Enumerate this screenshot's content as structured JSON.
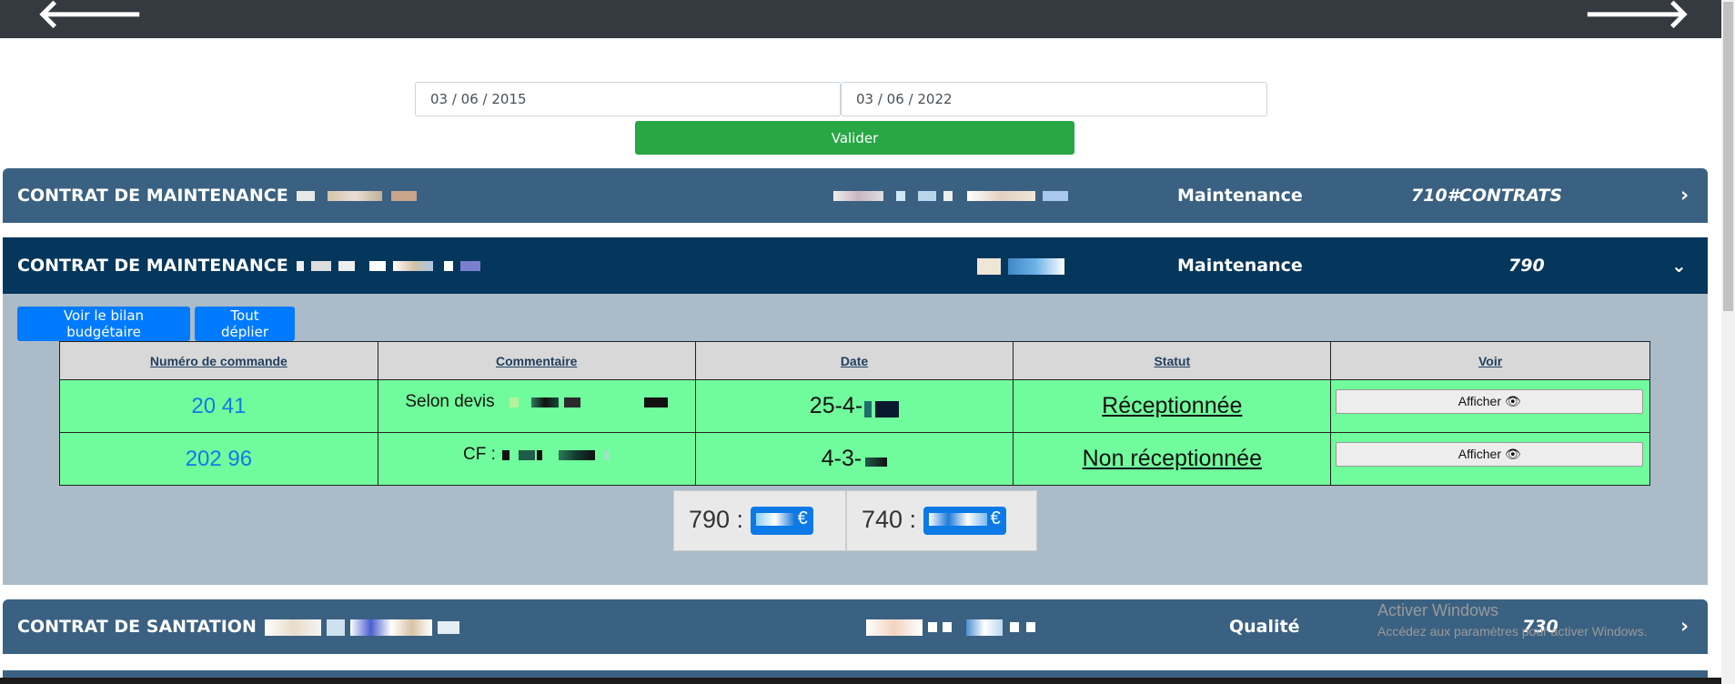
{
  "nav": {
    "prev_label": "🡐",
    "next_label": "🡒"
  },
  "filters": {
    "start_date": "03 / 06 / 2015",
    "end_date": "03 / 06 / 2022",
    "submit_label": "Valider"
  },
  "contracts": [
    {
      "title": "CONTRAT DE MAINTENANCE",
      "category": "Maintenance",
      "code": "710#CONTRATS",
      "expanded": false
    },
    {
      "title": "CONTRAT DE MAINTENANCE",
      "category": "Maintenance",
      "code": "790",
      "expanded": true
    },
    {
      "title": "CONTRAT DE SANTATION",
      "category": "Qualité",
      "code": "730",
      "expanded": false
    }
  ],
  "panel": {
    "budget_button_label": "Voir le bilan budgétaire",
    "expand_all_label": "Tout déplier",
    "columns": [
      "Numéro de commande",
      "Commentaire",
      "Date",
      "Statut",
      "Voir"
    ],
    "orders": [
      {
        "number": "20      41",
        "comment": "Selon devis",
        "date": "25-4-",
        "status": "Réceptionnée",
        "action": "Afficher"
      },
      {
        "number": "202     96",
        "comment": "CF :",
        "date": "4-3-",
        "status": "Non réceptionnée",
        "action": "Afficher"
      }
    ],
    "budgets": [
      {
        "code": "790 :",
        "currency": "€"
      },
      {
        "code": "740 :",
        "currency": "€"
      }
    ]
  },
  "windows_watermark": {
    "title": "Activer Windows",
    "subtitle": "Accédez aux paramètres pour activer Windows."
  },
  "colors": {
    "header_light": "#3a6181",
    "header_dark": "#05365c",
    "row_green": "#70fc9c",
    "accent_blue": "#007bff",
    "valider_green": "#28a745"
  }
}
